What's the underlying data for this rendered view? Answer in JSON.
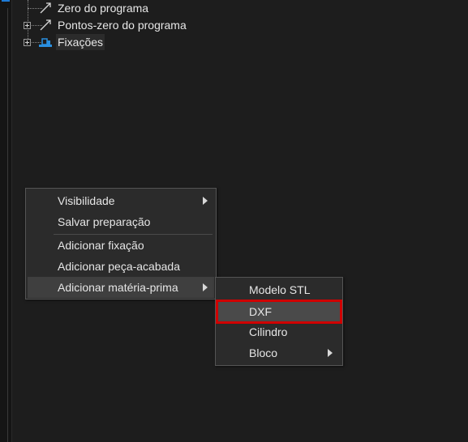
{
  "tree": {
    "items": [
      {
        "label": "Zero do programa",
        "icon": "arrow-icon"
      },
      {
        "label": "Pontos-zero do programa",
        "icon": "arrow-icon"
      },
      {
        "label": "Fixações",
        "icon": "fixture-icon"
      }
    ]
  },
  "context_menu": {
    "items": [
      {
        "label": "Visibilidade",
        "submenu": true
      },
      {
        "label": "Salvar preparação"
      },
      {
        "label": "Adicionar fixação"
      },
      {
        "label": "Adicionar peça-acabada"
      },
      {
        "label": "Adicionar matéria-prima",
        "submenu": true,
        "highlighted": true
      }
    ]
  },
  "submenu": {
    "items": [
      {
        "label": "Modelo STL"
      },
      {
        "label": "DXF",
        "highlighted": true
      },
      {
        "label": "Cilindro"
      },
      {
        "label": "Bloco",
        "submenu": true
      }
    ]
  },
  "colors": {
    "background": "#1d1d1d",
    "menu_bg": "#2b2b2b",
    "highlight_box": "#d00000",
    "accent": "#1e7bd6"
  }
}
